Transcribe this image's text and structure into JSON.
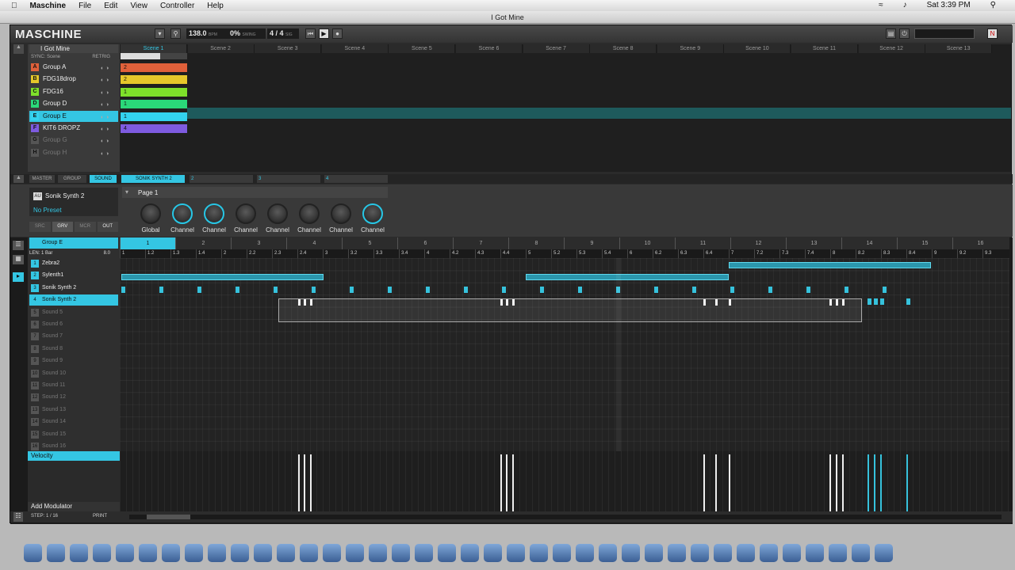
{
  "menubar": {
    "apple": "",
    "app": "Maschine",
    "items": [
      "File",
      "Edit",
      "View",
      "Controller",
      "Help"
    ],
    "clock": "Sat 3:39 PM"
  },
  "window": {
    "title": "I Got Mine"
  },
  "toolbar": {
    "logo": "MASCHINE",
    "tempo": "138.0",
    "tempo_unit": "BPM",
    "swing": "0%",
    "swing_unit": "SWING",
    "signature": "4 / 4",
    "signature_unit": "SIG"
  },
  "arranger": {
    "project": "I Got Mine",
    "sync": "SYNC: Scene",
    "retrig": "RETRIG",
    "scenes": [
      "Scene 1",
      "Scene 2",
      "Scene 3",
      "Scene 4",
      "Scene 5",
      "Scene 6",
      "Scene 7",
      "Scene 8",
      "Scene 9",
      "Scene 10",
      "Scene 11",
      "Scene 12",
      "Scene 13"
    ],
    "groups": [
      {
        "letter": "A",
        "name": "Group A",
        "color": "#e0603a",
        "clip": "2"
      },
      {
        "letter": "B",
        "name": "FDG18drop",
        "color": "#e6c72a",
        "clip": "2"
      },
      {
        "letter": "C",
        "name": "FDG16",
        "color": "#7ee02a",
        "clip": "1"
      },
      {
        "letter": "D",
        "name": "Group D",
        "color": "#2ad879",
        "clip": "1"
      },
      {
        "letter": "E",
        "name": "Group E",
        "color": "#33d3ef",
        "clip": "1"
      },
      {
        "letter": "F",
        "name": "KIT6 DROPZ",
        "color": "#7e5be0",
        "clip": "4"
      },
      {
        "letter": "G",
        "name": "Group G",
        "color": "#555",
        "clip": ""
      },
      {
        "letter": "H",
        "name": "Group H",
        "color": "#555",
        "clip": ""
      }
    ]
  },
  "control": {
    "tabs": [
      "MASTER",
      "GROUP",
      "SOUND"
    ],
    "slot1": "SONIK SYNTH 2",
    "slot2": "2",
    "slot3": "3",
    "slot4": "4",
    "plugin": "Sonik Synth 2",
    "plugin_badge": "AU",
    "preset": "No Preset",
    "subtabs": [
      "SRC",
      "GRV",
      "MCR",
      "OUT"
    ],
    "page": "Page 1",
    "knobs": [
      "Global",
      "Channel",
      "Channel",
      "Channel",
      "Channel",
      "Channel",
      "Channel",
      "Channel"
    ]
  },
  "pattern": {
    "group": "Group E",
    "length": "LEN: 1 Bar",
    "zoom": "8.0",
    "bars": [
      "1",
      "2",
      "3",
      "4",
      "5",
      "6",
      "7",
      "8",
      "9",
      "10",
      "11",
      "12",
      "13",
      "14",
      "15",
      "16"
    ],
    "ruler_ticks": [
      "1",
      "1.2",
      "1.3",
      "1.4",
      "2",
      "2.2",
      "2.3",
      "2.4",
      "3",
      "3.2",
      "3.3",
      "3.4",
      "4",
      "4.2",
      "4.3",
      "4.4",
      "5",
      "5.2",
      "5.3",
      "5.4",
      "6",
      "6.2",
      "6.3",
      "6.4",
      "7",
      "7.2",
      "7.3",
      "7.4",
      "8",
      "8.2",
      "8.3",
      "8.4",
      "9",
      "9.2",
      "9.3"
    ],
    "sounds": [
      "Zebra2",
      "Sylenth1",
      "Sonik Synth 2",
      "Sonik Synth 2",
      "Sound 5",
      "Sound 6",
      "Sound 7",
      "Sound 8",
      "Sound 9",
      "Sound 10",
      "Sound 11",
      "Sound 12",
      "Sound 13",
      "Sound 14",
      "Sound 15",
      "Sound 16"
    ],
    "velocity": "Velocity",
    "modulator": "Add Modulator",
    "step": "STEP: 1 / 16",
    "print": "PRINT"
  }
}
